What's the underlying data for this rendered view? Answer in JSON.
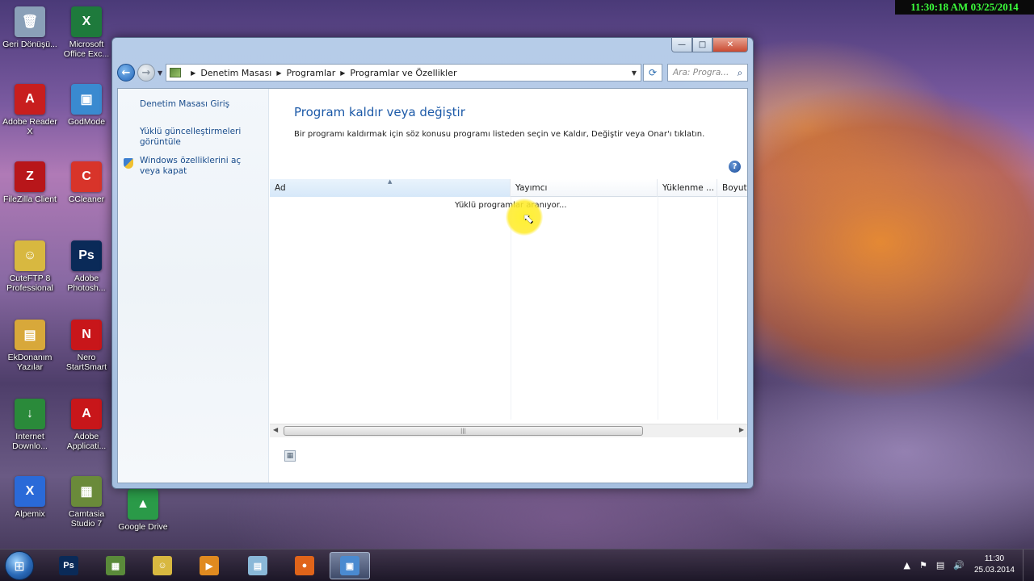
{
  "overlay_clock": "11:30:18 AM 03/25/2014",
  "desktop_icons": [
    {
      "label": "Geri Dönüşü...",
      "icon": "recycle-bin-icon",
      "color": "#8aa0b8",
      "glyph": "🗑"
    },
    {
      "label": "Microsoft Office Exc...",
      "icon": "excel-icon",
      "color": "#1e7a3c",
      "glyph": "X"
    },
    {
      "label": "Adobe Reader X",
      "icon": "adobe-reader-icon",
      "color": "#c81e1e",
      "glyph": "A"
    },
    {
      "label": "GodMode",
      "icon": "godmode-icon",
      "color": "#3a8ad0",
      "glyph": "▣"
    },
    {
      "label": "FileZilla Client",
      "icon": "filezilla-icon",
      "color": "#b8161a",
      "glyph": "Z"
    },
    {
      "label": "CCleaner",
      "icon": "ccleaner-icon",
      "color": "#d8342a",
      "glyph": "C"
    },
    {
      "label": "CuteFTP 8 Professional",
      "icon": "cuteftp-icon",
      "color": "#d8b840",
      "glyph": "☺"
    },
    {
      "label": "Adobe Photosh...",
      "icon": "photoshop-icon",
      "color": "#0a2a58",
      "glyph": "Ps"
    },
    {
      "label": "EkDonanım Yazılar",
      "icon": "folder-icon",
      "color": "#d8a83a",
      "glyph": "▤"
    },
    {
      "label": "Nero StartSmart",
      "icon": "nero-icon",
      "color": "#c8161a",
      "glyph": "N"
    },
    {
      "label": "Internet Downlo...",
      "icon": "internet-download-manager-icon",
      "color": "#2a8a3a",
      "glyph": "↓"
    },
    {
      "label": "Adobe Applicati...",
      "icon": "adobe-application-manager-icon",
      "color": "#c8161a",
      "glyph": "A"
    },
    {
      "label": "Alpemix",
      "icon": "alpemix-icon",
      "color": "#2a6ad8",
      "glyph": "X"
    },
    {
      "label": "Camtasia Studio 7",
      "icon": "camtasia-icon",
      "color": "#6a8a3a",
      "glyph": "▦"
    },
    {
      "label": "Google Drive",
      "icon": "google-drive-icon",
      "color": "#2a9a48",
      "glyph": "▲"
    }
  ],
  "window": {
    "title": "",
    "buttons": {
      "minimize": "—",
      "maximize": "□",
      "close": "✕"
    },
    "breadcrumb": [
      "Denetim Masası",
      "Programlar",
      "Programlar ve Özellikler"
    ],
    "search_placeholder": "Ara: Progra...",
    "left_links": [
      "Denetim Masası Giriş",
      "Yüklü güncelleştirmeleri görüntüle",
      "Windows özelliklerini aç veya kapat"
    ],
    "heading": "Program kaldır veya değiştir",
    "description": "Bir programı kaldırmak için söz konusu programı listeden seçin ve Kaldır, Değiştir veya Onar'ı tıklatın.",
    "help": "?",
    "columns": [
      "Ad",
      "Yayımcı",
      "Yüklenme ...",
      "Boyut"
    ],
    "loading_text": "Yüklü programlar aranıyor..."
  },
  "taskbar": {
    "apps": [
      {
        "icon": "photoshop-icon",
        "label": "Ps",
        "color": "#0a2a58",
        "active": false
      },
      {
        "icon": "camtasia-icon",
        "label": "▦",
        "color": "#5a8a3a",
        "active": false
      },
      {
        "icon": "cuteftp-icon",
        "label": "☺",
        "color": "#d8b840",
        "active": false
      },
      {
        "icon": "media-player-icon",
        "label": "▶",
        "color": "#e08a20",
        "active": false
      },
      {
        "icon": "notepad-icon",
        "label": "▤",
        "color": "#8ab8d8",
        "active": false
      },
      {
        "icon": "firefox-icon",
        "label": "●",
        "color": "#e0641a",
        "active": false
      },
      {
        "icon": "control-panel-icon",
        "label": "▣",
        "color": "#4a8ad0",
        "active": true
      }
    ],
    "time": "11:30",
    "date": "25.03.2014"
  }
}
